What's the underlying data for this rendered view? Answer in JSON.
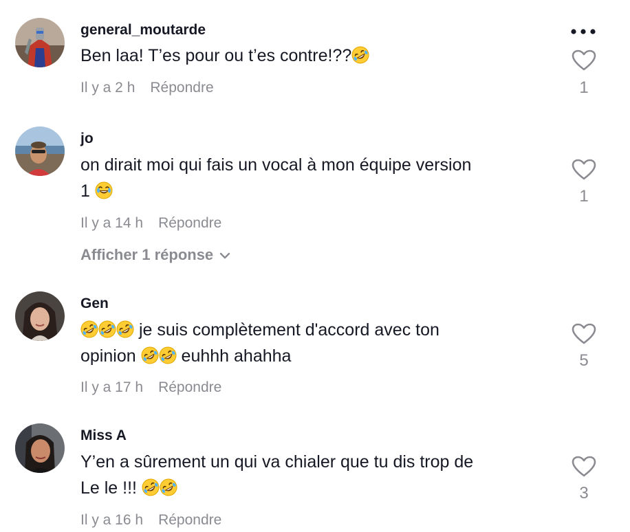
{
  "colors": {
    "text": "#161823",
    "muted": "#8a8b91"
  },
  "icons": {
    "more": "more-options-icon",
    "like": "heart-outline-icon",
    "chevron": "chevron-down-icon",
    "emoji_rofl": "rolling-on-floor-laughing-emoji",
    "emoji_joy": "face-with-tears-of-joy-emoji"
  },
  "comments": [
    {
      "username": "general_moutarde",
      "text": "Ben laa! T’es pour ou t’es contre!??",
      "time": "Il y a 2 h",
      "reply": "Répondre",
      "likes": "1"
    },
    {
      "username": "jo",
      "text_line1": "on dirait moi qui fais un vocal à mon équipe version",
      "text_line2": "1",
      "time": "Il y a 14 h",
      "reply": "Répondre",
      "likes": "1",
      "view_replies": "Afficher 1 réponse"
    },
    {
      "username": "Gen",
      "text_part1": "je suis complètement d'accord avec ton",
      "text_part2": "opinion",
      "text_part3": "euhhh ahahha",
      "time": "Il y a 17 h",
      "reply": "Répondre",
      "likes": "5"
    },
    {
      "username": "Miss A",
      "text_line1": "Y’en a sûrement un qui va chialer que tu dis trop de",
      "text_line2": "Le le !!!",
      "time": "Il y a 16 h",
      "reply": "Répondre",
      "likes": "3"
    }
  ]
}
